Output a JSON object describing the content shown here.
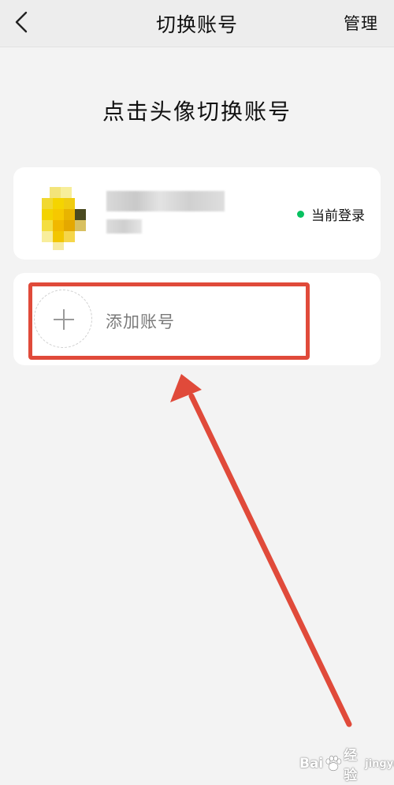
{
  "nav": {
    "title": "切换账号",
    "manage_label": "管理"
  },
  "heading": "点击头像切换账号",
  "accounts": [
    {
      "status_label": "当前登录"
    }
  ],
  "add_account": {
    "label": "添加账号"
  },
  "watermark": {
    "brand_left": "Bai",
    "brand_right": "经验",
    "sub": "jingyan"
  },
  "colors": {
    "status_dot": "#07c160",
    "annotation": "#e04a3a",
    "background": "#f3f3f3"
  }
}
